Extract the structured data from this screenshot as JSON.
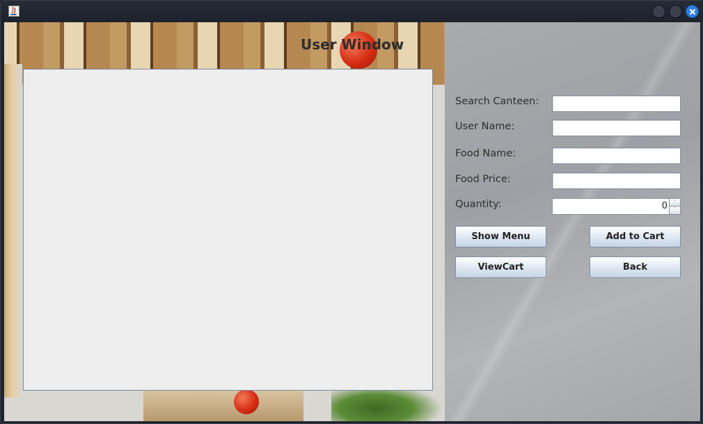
{
  "window": {
    "title": "User Window"
  },
  "form": {
    "search_canteen_label": "Search Canteen:",
    "search_canteen_value": "",
    "user_name_label": "User Name:",
    "user_name_value": "",
    "food_name_label": "Food Name:",
    "food_name_value": "",
    "food_price_label": "Food Price:",
    "food_price_value": "",
    "quantity_label": "Quantity:",
    "quantity_value": "0",
    "spinner_up": "˄",
    "spinner_down": "˅"
  },
  "buttons": {
    "show_menu": "Show Menu",
    "add_to_cart": "Add to Cart",
    "view_cart": "ViewCart",
    "back": "Back"
  },
  "colors": {
    "close_button": "#2f7de0",
    "titlebar": "#20252f"
  }
}
